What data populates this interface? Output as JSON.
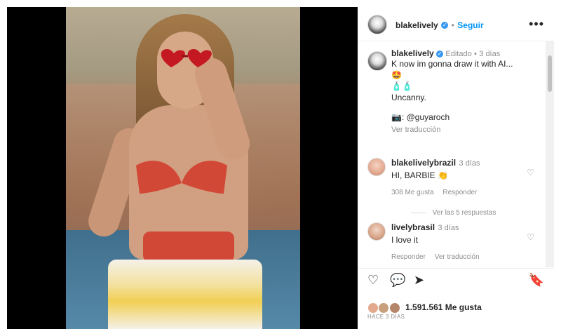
{
  "post_header": {
    "username": "blakelively",
    "follow_label": "Seguir",
    "more_label": "•••"
  },
  "caption": {
    "username": "blakelively",
    "edited": "Editado",
    "time": "3 días",
    "line1": "K now im gonna draw it with AI...",
    "line2": "🤩",
    "line3": "🧴🧴",
    "line4": "Uncanny.",
    "line5": "📷: @guyaroch",
    "translate": "Ver traducción"
  },
  "comments": [
    {
      "username": "blakelivelybrazil",
      "time": "3 días",
      "text": "HI, BARBIE 👏",
      "likes": "308 Me gusta",
      "reply": "Responder",
      "replies_label": "Ver las 5 respuestas"
    },
    {
      "username": "livelybrasil",
      "time": "3 días",
      "text": "I love it",
      "reply": "Responder",
      "translate": "Ver traducción"
    }
  ],
  "footer": {
    "likes_count": "1.591.561 Me gusta",
    "date": "HACE 3 DÍAS"
  },
  "icons": {
    "like": "heart-icon",
    "comment": "comment-icon",
    "share": "share-icon",
    "save": "bookmark-icon"
  }
}
